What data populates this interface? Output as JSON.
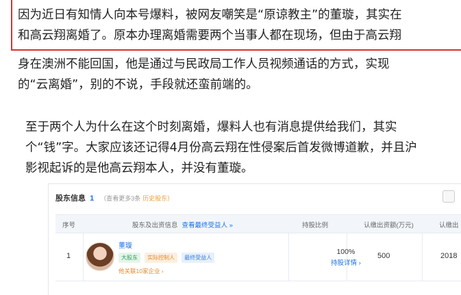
{
  "article": {
    "lines": [
      "因为近日有知情人向本号爆料，被网友嘲笑是“原谅教主”的董璇，其实在",
      "和高云翔离婚了。原本办理离婚需要两个当事人都在现场，但由于高云翔",
      "身在澳洲不能回国，他是通过与民政局工作人员视频通话的方式，实现",
      "的“云离婚”，别的不说，手段就还蛮前端的。"
    ],
    "lines2": [
      "至于两个人为什么在这个时刻离婚，爆料人也有消息提供给我们，其实",
      "个“钱”字。大家应该还记得4月份高云翔在性侵案后首发微博道歉，并且沪",
      "影视起诉的是他高云翔本人，并没有董璇。"
    ]
  },
  "card": {
    "title": "股东信息",
    "count": "1",
    "more": "（查看更多3条",
    "history": "历史股东）",
    "headers": {
      "index": "序号",
      "holder": "股东及出资信息",
      "holder_link": "查看最终受益人 »",
      "ratio": "持股比例",
      "capital": "认缴出资额(万元)",
      "date": "认缴出"
    },
    "row": {
      "index": "1",
      "name": "董璇",
      "tags": [
        "大股东",
        "实际控制人",
        "最终受益人"
      ],
      "related": "他关联10家企业 ›",
      "ratio": "100%",
      "ratio_detail": "持股详情 ›",
      "capital": "500",
      "date": "2018"
    }
  },
  "colors": {
    "highlight_border": "#d6342c",
    "link": "#1a73e8",
    "header_bg": "#f2f6fb"
  }
}
